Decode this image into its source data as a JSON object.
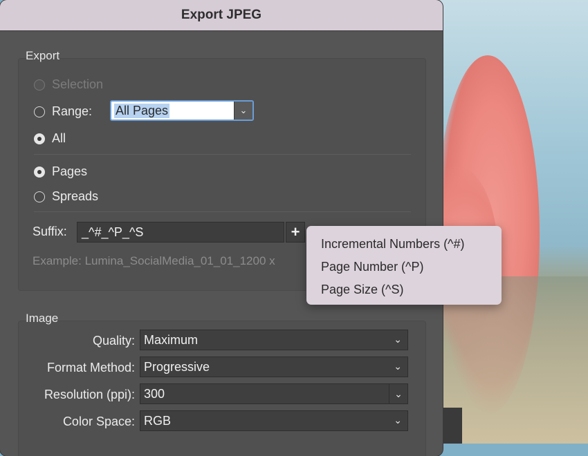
{
  "window": {
    "title": "Export JPEG"
  },
  "export": {
    "group_title": "Export",
    "selection_label": "Selection",
    "range_label": "Range:",
    "range_value": "All Pages",
    "all_label": "All",
    "pages_label": "Pages",
    "spreads_label": "Spreads",
    "suffix_label": "Suffix:",
    "suffix_value": "_^#_^P_^S",
    "plus_button": "+",
    "example_text": "Example:  Lumina_SocialMedia_01_01_1200 x"
  },
  "suffix_menu": {
    "items": [
      {
        "label": "Incremental Numbers (^#)"
      },
      {
        "label": "Page Number (^P)"
      },
      {
        "label": "Page Size (^S)"
      }
    ]
  },
  "image": {
    "group_title": "Image",
    "quality_label": "Quality:",
    "quality_value": "Maximum",
    "format_label": "Format Method:",
    "format_value": "Progressive",
    "resolution_label": "Resolution (ppi):",
    "resolution_value": "300",
    "colorspace_label": "Color Space:",
    "colorspace_value": "RGB"
  },
  "icons": {
    "chevron": "chevron-down-icon",
    "plus": "plus-icon"
  },
  "colors": {
    "dialog_bg": "#555555",
    "titlebar_bg": "#d6ccd6",
    "focus_ring": "#6a9ed8",
    "popup_bg": "#ddd3dc"
  }
}
